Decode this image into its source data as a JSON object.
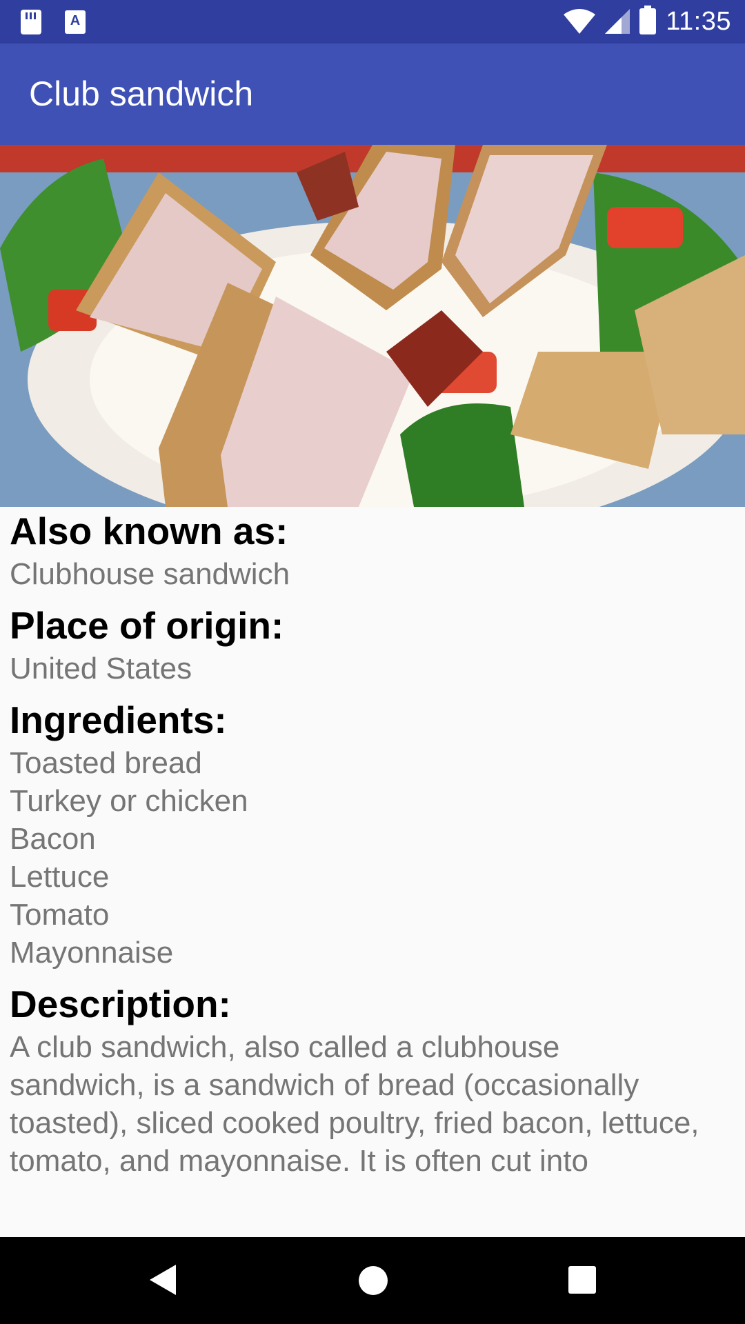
{
  "status_bar": {
    "time": "11:35",
    "icons": [
      "sd-card-icon",
      "a-notification-icon",
      "wifi-icon",
      "signal-icon",
      "battery-charging-icon"
    ]
  },
  "app_bar": {
    "title": "Club sandwich"
  },
  "details": {
    "also_known_as": {
      "label": "Also known as:",
      "value": "Clubhouse sandwich"
    },
    "place_of_origin": {
      "label": "Place of origin:",
      "value": "United States"
    },
    "ingredients": {
      "label": "Ingredients:",
      "items": [
        "Toasted bread",
        "Turkey or chicken",
        "Bacon",
        "Lettuce",
        "Tomato",
        "Mayonnaise"
      ]
    },
    "description": {
      "label": "Description:",
      "lines": [
        "A club sandwich, also called a clubhouse",
        "sandwich, is a sandwich of bread (occasionally",
        "toasted), sliced cooked poultry, fried bacon, lettuce,",
        "tomato, and mayonnaise. It is often cut into"
      ]
    }
  },
  "nav_bar": {
    "icons": [
      "back-icon",
      "home-icon",
      "recents-icon"
    ]
  },
  "colors": {
    "status_bar": "#303f9f",
    "app_bar": "#3f51b5",
    "heading": "#000000",
    "body_text": "#757575"
  }
}
